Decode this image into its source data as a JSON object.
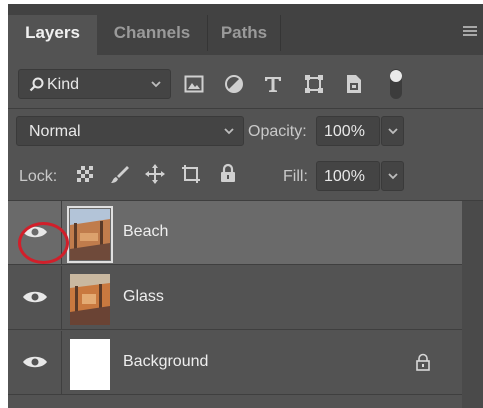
{
  "tabs": [
    {
      "label": "Layers",
      "active": true
    },
    {
      "label": "Channels",
      "active": false
    },
    {
      "label": "Paths",
      "active": false
    }
  ],
  "filter": {
    "kind_label": "Kind",
    "icons": [
      "image-filter-icon",
      "adjustment-filter-icon",
      "type-filter-icon",
      "shape-filter-icon",
      "smart-object-filter-icon",
      "filter-toggle-icon"
    ]
  },
  "blend": {
    "mode": "Normal",
    "opacity_label": "Opacity:",
    "opacity_value": "100%"
  },
  "lock": {
    "label": "Lock:",
    "icons": [
      "lock-transparent-pixels-icon",
      "lock-image-pixels-icon",
      "lock-position-icon",
      "prevent-auto-nesting-icon",
      "lock-all-icon"
    ],
    "fill_label": "Fill:",
    "fill_value": "100%"
  },
  "layers": [
    {
      "name": "Beach",
      "selected": true,
      "visible": true,
      "locked": false
    },
    {
      "name": "Glass",
      "selected": false,
      "visible": true,
      "locked": false
    },
    {
      "name": "Background",
      "selected": false,
      "visible": true,
      "locked": true
    }
  ],
  "colors": {
    "panel": "#535353",
    "tabbar": "#424242",
    "selected_row": "#6a6a6a",
    "highlight_ring": "#d11f2a"
  }
}
